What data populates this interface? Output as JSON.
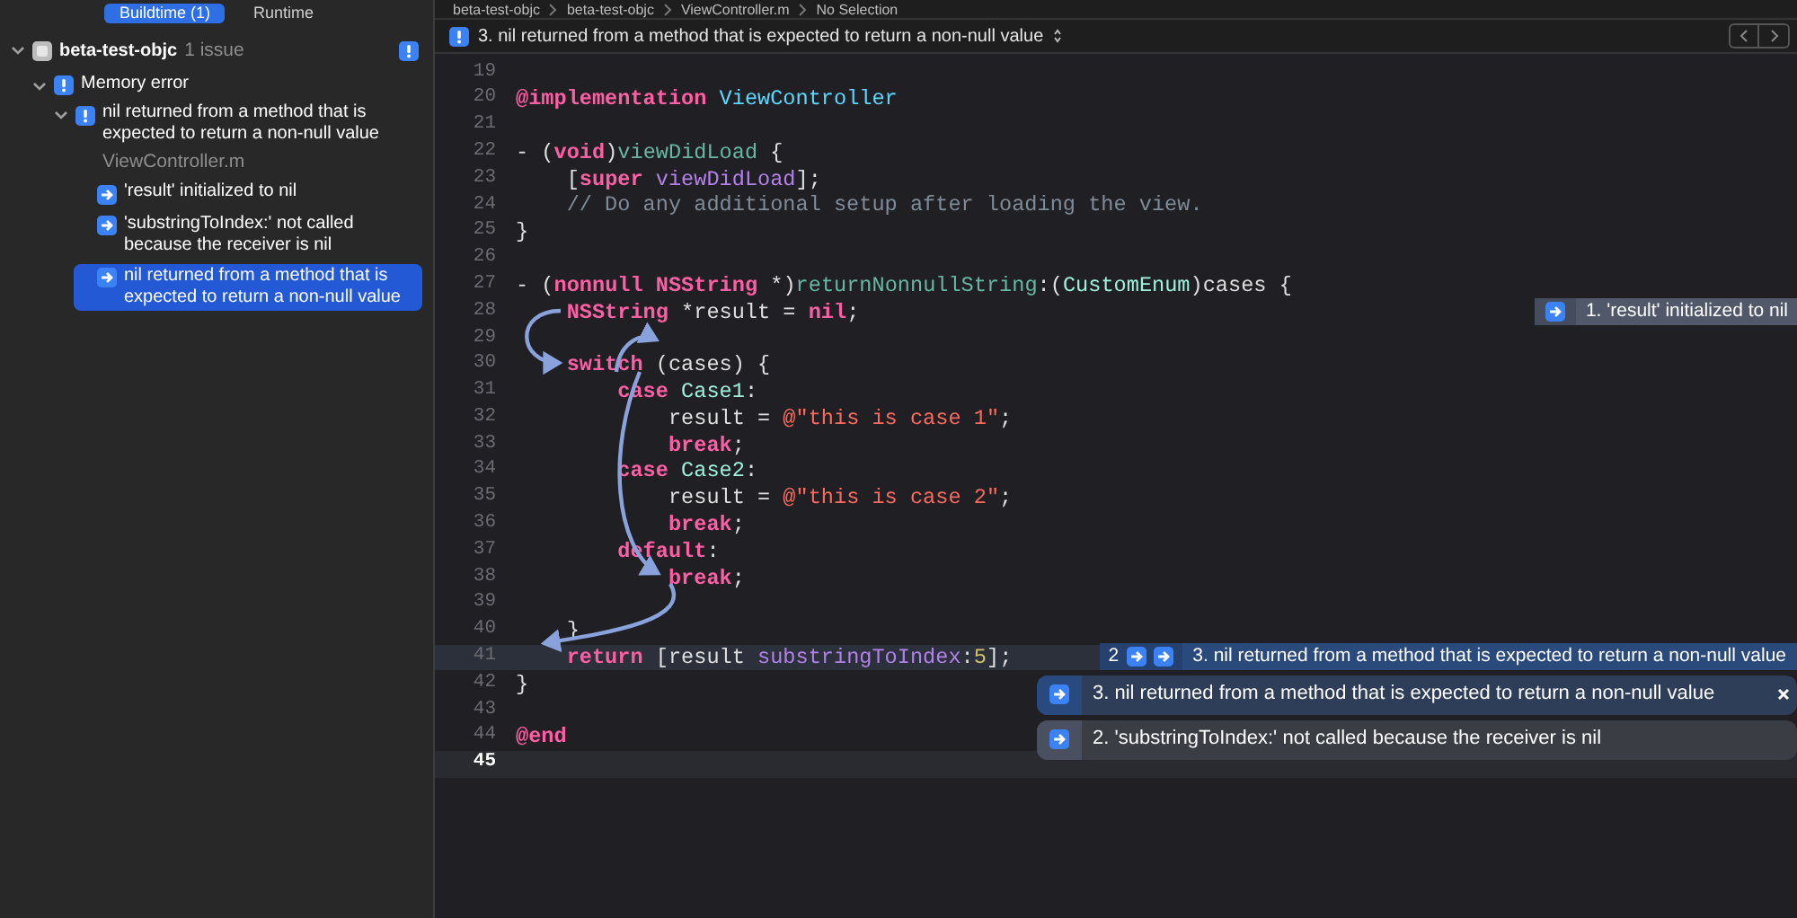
{
  "sidebar": {
    "tabs": [
      {
        "label": "Buildtime (1)",
        "selected": true
      },
      {
        "label": "Runtime",
        "selected": false
      }
    ],
    "tree": [
      {
        "kind": "project",
        "label": "beta-test-objc",
        "count": "1 issue",
        "expanded": true,
        "children": [
          {
            "kind": "category",
            "label": "Memory error",
            "expanded": true,
            "children": [
              {
                "kind": "issue",
                "label": "nil returned from a method that is expected to return a non-null value",
                "file": "ViewController.m",
                "expanded": true,
                "children": [
                  {
                    "kind": "step",
                    "label": "'result' initialized to nil",
                    "selected": false
                  },
                  {
                    "kind": "step",
                    "label": "'substringToIndex:' not called because the receiver is nil",
                    "selected": false
                  },
                  {
                    "kind": "step",
                    "label": "nil returned from a method that is expected to return a non-null value",
                    "selected": true
                  }
                ]
              }
            ]
          }
        ]
      }
    ]
  },
  "breadcrumb": [
    "beta-test-objc",
    "beta-test-objc",
    "ViewController.m",
    "No Selection"
  ],
  "issue_bar": {
    "text": "3. nil returned from a method that is expected to return a non-null value"
  },
  "code": [
    {
      "number": "19",
      "highlighted": false,
      "cursor": false
    },
    {
      "number": "20",
      "highlighted": false,
      "cursor": false,
      "tokens": [
        {
          "text": "@implementation ",
          "kind": "keyword"
        },
        {
          "text": "ViewController",
          "kind": "typedecl"
        }
      ]
    },
    {
      "number": "21",
      "highlighted": false,
      "cursor": false
    },
    {
      "number": "22",
      "highlighted": false,
      "cursor": false,
      "tokens": [
        {
          "text": "- (",
          "kind": "plain"
        },
        {
          "text": "void",
          "kind": "keyword"
        },
        {
          "text": ")",
          "kind": "plain"
        },
        {
          "text": "viewDidLoad",
          "kind": "decl"
        },
        {
          "text": " {",
          "kind": "plain"
        }
      ]
    },
    {
      "number": "23",
      "highlighted": false,
      "cursor": false,
      "tokens": [
        {
          "text": "    [",
          "kind": "plain"
        },
        {
          "text": "super ",
          "kind": "keyword"
        },
        {
          "text": "viewDidLoad",
          "kind": "call"
        },
        {
          "text": "];",
          "kind": "plain"
        }
      ]
    },
    {
      "number": "24",
      "highlighted": false,
      "cursor": false,
      "tokens": [
        {
          "text": "    // Do any additional setup after loading the view.",
          "kind": "comment"
        }
      ]
    },
    {
      "number": "25",
      "highlighted": false,
      "cursor": false,
      "tokens": [
        {
          "text": "}",
          "kind": "plain"
        }
      ]
    },
    {
      "number": "26",
      "highlighted": false,
      "cursor": false
    },
    {
      "number": "27",
      "highlighted": false,
      "cursor": false,
      "tokens": [
        {
          "text": "- (",
          "kind": "plain"
        },
        {
          "text": "nonnull NSString",
          "kind": "keyword"
        },
        {
          "text": " *)",
          "kind": "plain"
        },
        {
          "text": "returnNonnullString",
          "kind": "decl"
        },
        {
          "text": ":(",
          "kind": "plain"
        },
        {
          "text": "CustomEnum",
          "kind": "type"
        },
        {
          "text": ")cases {",
          "kind": "plain"
        }
      ]
    },
    {
      "number": "28",
      "highlighted": false,
      "cursor": false,
      "tokens": [
        {
          "text": "    NSString",
          "kind": "keyword"
        },
        {
          "text": " *result = ",
          "kind": "plain"
        },
        {
          "text": "nil",
          "kind": "keyword"
        },
        {
          "text": ";",
          "kind": "plain"
        }
      ],
      "annotation": {
        "kind": "step",
        "text": "1. 'result' initialized to nil"
      }
    },
    {
      "number": "29",
      "highlighted": false,
      "cursor": false
    },
    {
      "number": "30",
      "highlighted": false,
      "cursor": false,
      "tokens": [
        {
          "text": "    switch",
          "kind": "keyword"
        },
        {
          "text": " (cases) {",
          "kind": "plain"
        }
      ]
    },
    {
      "number": "31",
      "highlighted": false,
      "cursor": false,
      "tokens": [
        {
          "text": "        case ",
          "kind": "keyword"
        },
        {
          "text": "Case1",
          "kind": "type"
        },
        {
          "text": ":",
          "kind": "plain"
        }
      ]
    },
    {
      "number": "32",
      "highlighted": false,
      "cursor": false,
      "tokens": [
        {
          "text": "            result = ",
          "kind": "plain"
        },
        {
          "text": "@\"this is case 1\"",
          "kind": "string"
        },
        {
          "text": ";",
          "kind": "plain"
        }
      ]
    },
    {
      "number": "33",
      "highlighted": false,
      "cursor": false,
      "tokens": [
        {
          "text": "            break",
          "kind": "keyword"
        },
        {
          "text": ";",
          "kind": "plain"
        }
      ]
    },
    {
      "number": "34",
      "highlighted": false,
      "cursor": false,
      "tokens": [
        {
          "text": "        case ",
          "kind": "keyword"
        },
        {
          "text": "Case2",
          "kind": "type"
        },
        {
          "text": ":",
          "kind": "plain"
        }
      ]
    },
    {
      "number": "35",
      "highlighted": false,
      "cursor": false,
      "tokens": [
        {
          "text": "            result = ",
          "kind": "plain"
        },
        {
          "text": "@\"this is case 2\"",
          "kind": "string"
        },
        {
          "text": ";",
          "kind": "plain"
        }
      ]
    },
    {
      "number": "36",
      "highlighted": false,
      "cursor": false,
      "tokens": [
        {
          "text": "            break",
          "kind": "keyword"
        },
        {
          "text": ";",
          "kind": "plain"
        }
      ]
    },
    {
      "number": "37",
      "highlighted": false,
      "cursor": false,
      "tokens": [
        {
          "text": "        default",
          "kind": "keyword"
        },
        {
          "text": ":",
          "kind": "plain"
        }
      ]
    },
    {
      "number": "38",
      "highlighted": false,
      "cursor": false,
      "tokens": [
        {
          "text": "            break",
          "kind": "keyword"
        },
        {
          "text": ";",
          "kind": "plain"
        }
      ]
    },
    {
      "number": "39",
      "highlighted": false,
      "cursor": false
    },
    {
      "number": "40",
      "highlighted": false,
      "cursor": false,
      "tokens": [
        {
          "text": "    }",
          "kind": "plain"
        }
      ]
    },
    {
      "number": "41",
      "highlighted": true,
      "cursor": false,
      "tokens": [
        {
          "text": "    return",
          "kind": "keyword"
        },
        {
          "text": " [result ",
          "kind": "plain"
        },
        {
          "text": "substringToIndex",
          "kind": "call"
        },
        {
          "text": ":",
          "kind": "plain"
        },
        {
          "text": "5",
          "kind": "number"
        },
        {
          "text": "];",
          "kind": "plain"
        }
      ],
      "annotation": {
        "kind": "group",
        "count": "2",
        "text": "3. nil returned from a method that is expected to return a non-null value",
        "popover": [
          {
            "text": "3. nil returned from a method that is expected to return a non-null value",
            "selected": true
          },
          {
            "text": "2. 'substringToIndex:' not called because the receiver is nil",
            "selected": false
          }
        ]
      }
    },
    {
      "number": "42",
      "highlighted": false,
      "cursor": false,
      "tokens": [
        {
          "text": "}",
          "kind": "plain"
        }
      ]
    },
    {
      "number": "43",
      "highlighted": false,
      "cursor": false
    },
    {
      "number": "44",
      "highlighted": false,
      "cursor": false,
      "tokens": [
        {
          "text": "@end",
          "kind": "keyword"
        }
      ]
    },
    {
      "number": "45",
      "highlighted": true,
      "cursor": true
    }
  ]
}
